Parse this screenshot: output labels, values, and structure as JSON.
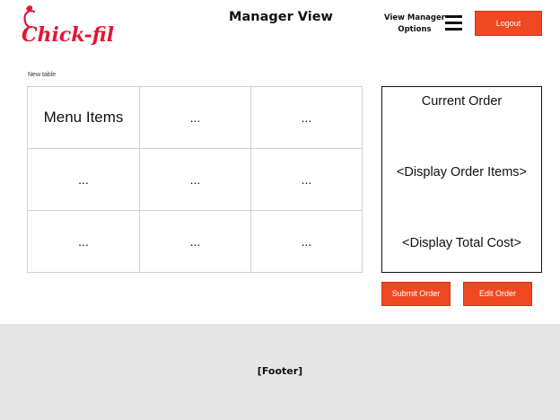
{
  "header": {
    "logo_text": "Chick-fil-A",
    "title": "Manager View",
    "options_label_line1": "View Manager",
    "options_label_line2": "Options",
    "logout_label": "Logout"
  },
  "menu_table": {
    "caption": "New table",
    "rows": [
      [
        "Menu Items",
        "...",
        "..."
      ],
      [
        "...",
        "...",
        "..."
      ],
      [
        "...",
        "...",
        "..."
      ]
    ]
  },
  "order_panel": {
    "title": "Current Order",
    "items_placeholder": "<Display Order Items>",
    "total_placeholder": "<Display Total Cost>"
  },
  "actions": {
    "submit_label": "Submit Order",
    "edit_label": "Edit Order"
  },
  "footer": {
    "label": "[Footer]"
  },
  "colors": {
    "brand_red": "#e51636",
    "button_orange": "#f04823",
    "footer_bg": "#e6e6e6"
  },
  "icons": [
    "chick-fil-a-logo",
    "hamburger-menu-icon"
  ]
}
